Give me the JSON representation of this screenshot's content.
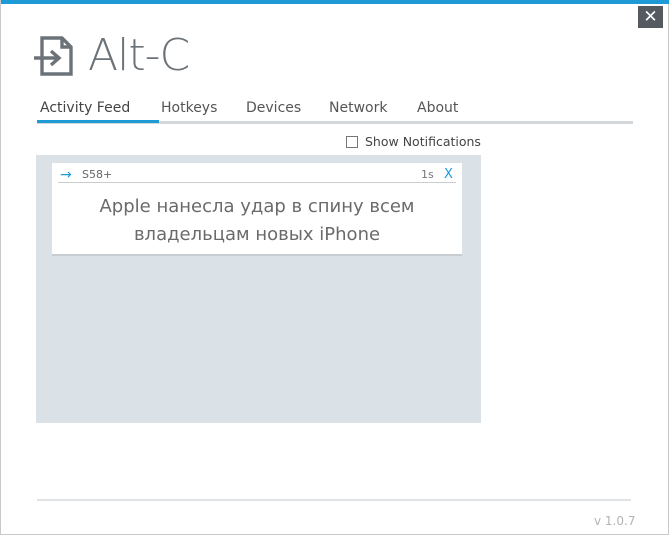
{
  "app": {
    "title": "Alt-C",
    "version": "v 1.0.7",
    "close_label": "✕",
    "logo_icon": "document-arrow-icon",
    "accent_color": "#1e9bd7"
  },
  "tabs": [
    {
      "label": "Activity Feed",
      "active": true
    },
    {
      "label": "Hotkeys"
    },
    {
      "label": "Devices"
    },
    {
      "label": "Network"
    },
    {
      "label": "About"
    }
  ],
  "notifications": {
    "label": "Show Notifications",
    "checked": false
  },
  "feed": {
    "items": [
      {
        "direction_icon": "→",
        "device": "S58+",
        "age": "1s",
        "remove_label": "X",
        "text_line1": "Apple нанесла удар в спину всем",
        "text_line2": "владельцам новых iPhone"
      }
    ]
  }
}
